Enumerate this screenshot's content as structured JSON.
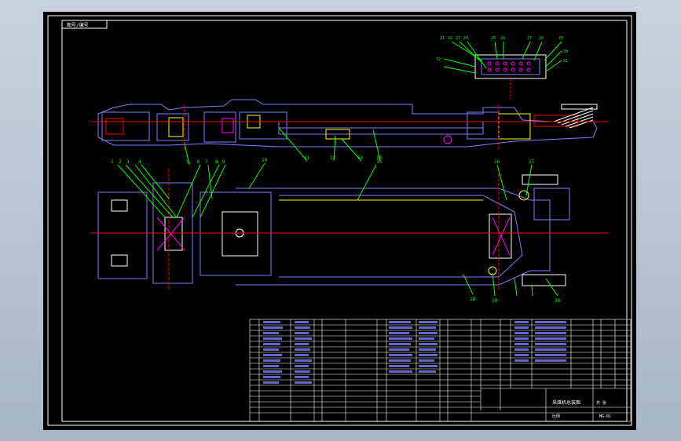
{
  "drawing": {
    "code_box": "图号/编号",
    "callouts_top": [
      "1",
      "2",
      "3",
      "4",
      "5",
      "6",
      "7",
      "8",
      "9",
      "10",
      "11",
      "12",
      "13",
      "14",
      "15"
    ],
    "callouts_bottom": [
      "16",
      "17",
      "18",
      "19",
      "20"
    ],
    "inset_callouts": [
      "21",
      "22",
      "23",
      "24",
      "25",
      "26",
      "27",
      "28",
      "29",
      "30",
      "31",
      "32"
    ],
    "title_block": {
      "title": "采煤机总装图",
      "sheet": "共 张",
      "scale": "比例",
      "drawing_no": "MG-01"
    }
  },
  "colors": {
    "background": "#000000",
    "frame": "#ffffff",
    "outline": "#8080ff",
    "centerline": "#ff0000",
    "callout": "#00ff00",
    "part": "#ffff00",
    "detail": "#ff00ff"
  }
}
